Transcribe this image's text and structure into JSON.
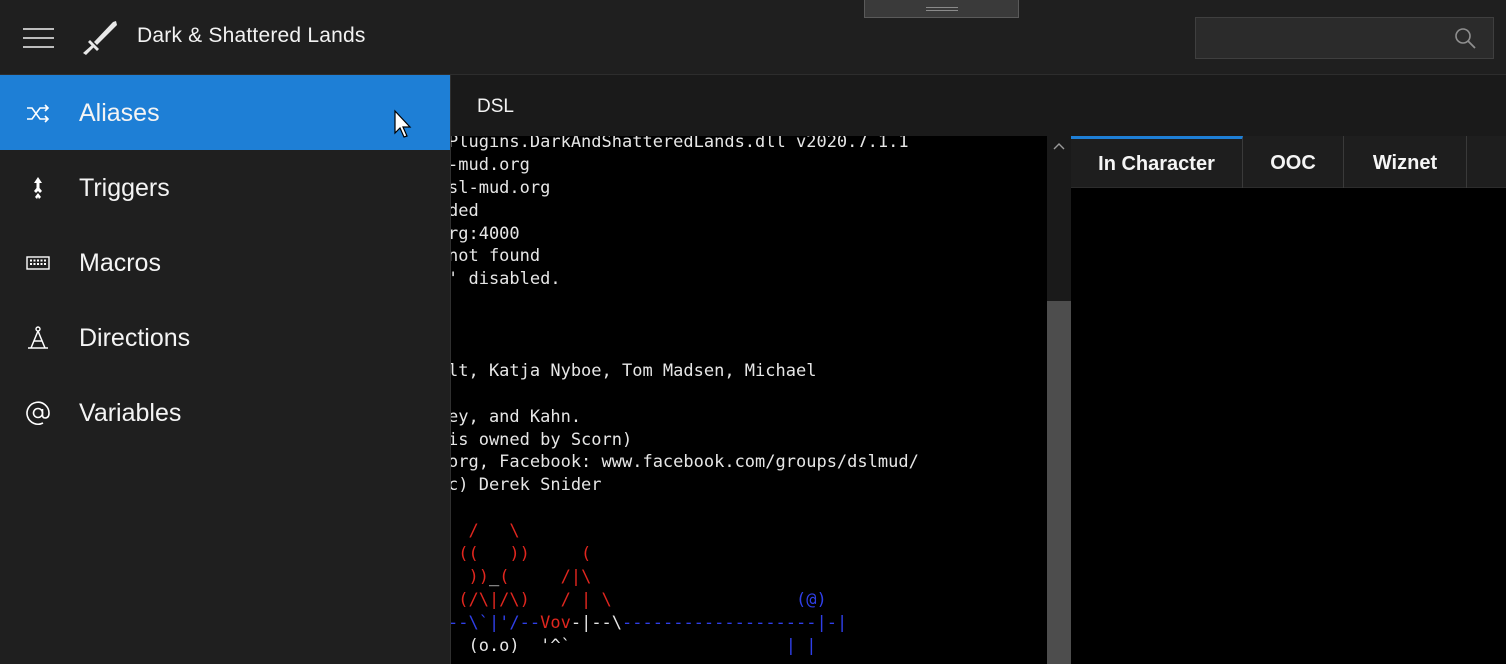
{
  "app": {
    "title": "Dark & Shattered Lands"
  },
  "search": {
    "placeholder": "",
    "value": ""
  },
  "sidebar": {
    "items": [
      {
        "label": "Aliases",
        "icon": "shuffle-icon",
        "active": true
      },
      {
        "label": "Triggers",
        "icon": "trigger-arrow-icon",
        "active": false
      },
      {
        "label": "Macros",
        "icon": "keyboard-icon",
        "active": false
      },
      {
        "label": "Directions",
        "icon": "compass-icon",
        "active": false
      },
      {
        "label": "Variables",
        "icon": "at-sign-icon",
        "active": false
      }
    ]
  },
  "main": {
    "tab_label": "DSL"
  },
  "channels": {
    "tabs": [
      {
        "label": "In Character",
        "active": true
      },
      {
        "label": "OOC",
        "active": false
      },
      {
        "label": "Wiznet",
        "active": false
      }
    ]
  },
  "terminal": {
    "lines": [
      [
        {
          "t": "Plugins.DarkAndShatteredLands.dll v2020.7.1.1",
          "c": "white"
        }
      ],
      [
        {
          "t": "-mud.org",
          "c": "white"
        }
      ],
      [
        {
          "t": "sl-mud.org",
          "c": "white"
        }
      ],
      [
        {
          "t": "ded",
          "c": "white"
        }
      ],
      [
        {
          "t": "rg:4000",
          "c": "white"
        }
      ],
      [
        {
          "t": "not found",
          "c": "white"
        }
      ],
      [
        {
          "t": "' disabled.",
          "c": "white"
        }
      ],
      [],
      [],
      [],
      [
        {
          "t": "lt, Katja Nyboe, Tom Madsen, Michael",
          "c": "white"
        }
      ],
      [],
      [
        {
          "t": "ey, and Kahn.",
          "c": "white"
        }
      ],
      [
        {
          "t": "is owned by Scorn)",
          "c": "white"
        }
      ],
      [
        {
          "t": "org, Facebook: www.facebook.com/groups/dslmud/",
          "c": "white"
        }
      ],
      [
        {
          "t": "c) Derek Snider",
          "c": "white"
        }
      ],
      [],
      [
        {
          "t": "  /   \\",
          "c": "red"
        }
      ],
      [
        {
          "t": " ((   ))     (",
          "c": "red"
        }
      ],
      [
        {
          "t": "  ))",
          "c": "red"
        },
        {
          "t": "_",
          "c": "white"
        },
        {
          "t": "(     /|\\",
          "c": "red"
        }
      ],
      [
        {
          "t": " (/\\|/\\)   / | \\",
          "c": "red"
        },
        {
          "t": "                  (@)",
          "c": "blue"
        }
      ],
      [
        {
          "t": "--\\`|'/--",
          "c": "blue"
        },
        {
          "t": "Vov",
          "c": "red"
        },
        {
          "t": "-|--\\",
          "c": "white"
        },
        {
          "t": "-------------------|-|",
          "c": "blue"
        }
      ],
      [
        {
          "t": "  (o.o)  '^`",
          "c": "white"
        },
        {
          "t": "                     | |",
          "c": "blue"
        }
      ]
    ]
  },
  "colors": {
    "accent": "#1e7fd6",
    "terminal_red": "#e0261e",
    "terminal_blue": "#2f3fe8",
    "terminal_white": "#e6e6e6"
  }
}
